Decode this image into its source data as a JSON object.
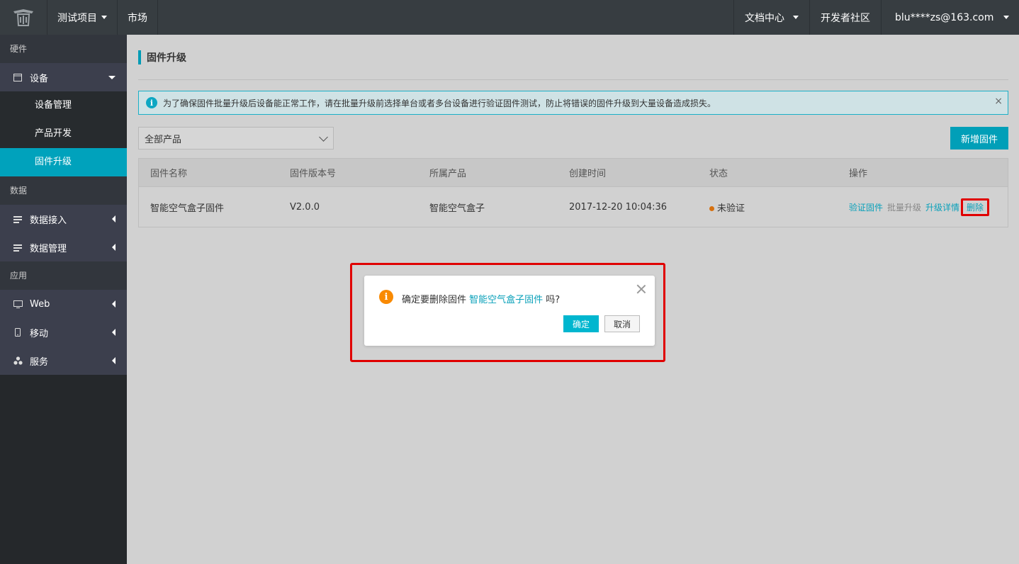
{
  "topbar": {
    "project": "测试项目",
    "market": "市场",
    "docs": "文档中心",
    "community": "开发者社区",
    "user": "blu****zs@163.com"
  },
  "sidebar": {
    "group_hardware": "硬件",
    "device": "设备",
    "device_manage": "设备管理",
    "product_dev": "产品开发",
    "firmware_upgrade": "固件升级",
    "group_data": "数据",
    "data_access": "数据接入",
    "data_manage": "数据管理",
    "group_app": "应用",
    "web": "Web",
    "mobile": "移动",
    "service": "服务"
  },
  "page": {
    "title": "固件升级",
    "alert": "为了确保固件批量升级后设备能正常工作，请在批量升级前选择单台或者多台设备进行验证固件测试，防止将错误的固件升级到大量设备造成损失。",
    "alert_close": "×",
    "product_select": "全部产品",
    "add_button": "新增固件"
  },
  "table": {
    "headers": [
      "固件名称",
      "固件版本号",
      "所属产品",
      "创建时间",
      "状态",
      "操作"
    ],
    "row": {
      "name": "智能空气盒子固件",
      "version": "V2.0.0",
      "product": "智能空气盒子",
      "created": "2017-12-20 10:04:36",
      "status": "未验证",
      "op_verify": "验证固件",
      "op_batch": "批量升级",
      "op_detail": "升级详情",
      "op_delete": "删除"
    }
  },
  "dialog": {
    "prefix": "确定要删除固件 ",
    "target": "智能空气盒子固件",
    "suffix": " 吗?",
    "ok": "确定",
    "cancel": "取消"
  },
  "colors": {
    "accent": "#00a2bc",
    "warning": "#f98a03",
    "status_unverified": "#d6700f",
    "highlight_frame": "#e00000"
  }
}
